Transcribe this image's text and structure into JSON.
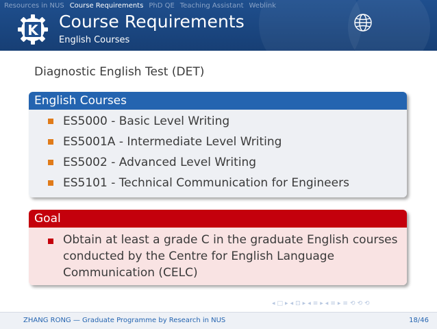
{
  "nav": {
    "items": [
      {
        "label": "Resources in NUS",
        "active": false
      },
      {
        "label": "Course Requirements",
        "active": true
      },
      {
        "label": "PhD QE",
        "active": false
      },
      {
        "label": "Teaching Assistant",
        "active": false
      },
      {
        "label": "Weblink",
        "active": false
      }
    ]
  },
  "header": {
    "title": "Course Requirements",
    "subtitle": "English Courses",
    "logo_icon": "kde-logo-icon",
    "right_icon": "globe-icon"
  },
  "content": {
    "intro": "Diagnostic English Test (DET)",
    "english_block": {
      "title": "English Courses",
      "items": [
        "ES5000 - Basic Level Writing",
        "ES5001A - Intermediate Level Writing",
        "ES5002 - Advanced Level Writing",
        "ES5101 - Technical Communication for Engineers"
      ]
    },
    "goal_block": {
      "title": "Goal",
      "items": [
        "Obtain at least a grade C in the graduate English courses conducted by the Centre for English Language Communication (CELC)"
      ]
    }
  },
  "beamer_nav": [
    "◂",
    "□",
    "▸",
    "◂",
    "⊡",
    "▸",
    "◂",
    "≡",
    "▸",
    "◂",
    "≡",
    "▸",
    "≡",
    "⟲",
    "⟲",
    "⟲"
  ],
  "footer": {
    "left": "ZHANG RONG — Graduate Programme by Research in NUS",
    "right": "18/46"
  },
  "colors": {
    "header_bg": "#1f4f8e",
    "blue_block": "#2464b0",
    "red_block": "#c4000c",
    "bullet_blue": "#e07b1a"
  }
}
